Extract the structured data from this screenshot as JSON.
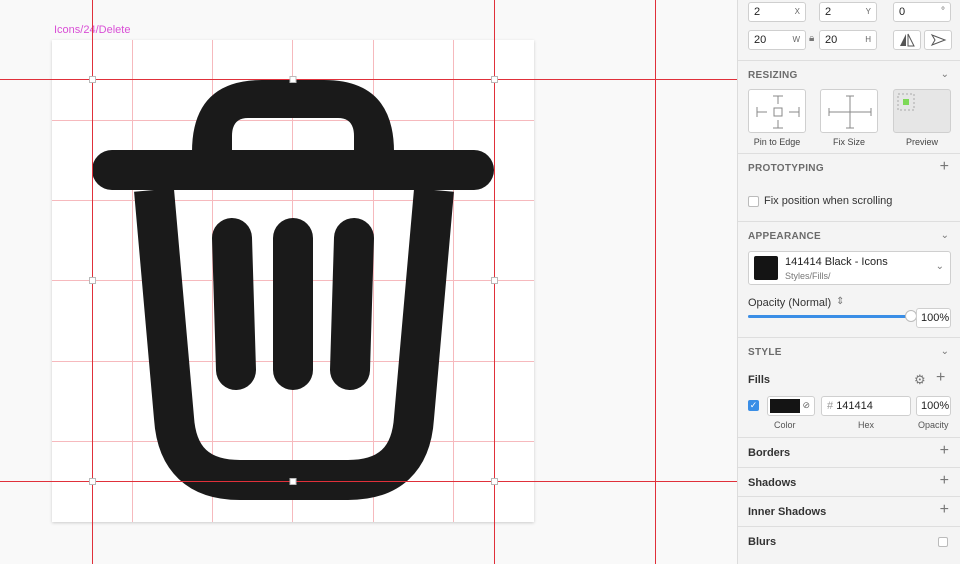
{
  "canvas": {
    "artboard_title": "Icons/24/Delete",
    "icon_fill": "#1a1a1a",
    "guide_color": "#e0303a",
    "grid_color": "#f3a7ad"
  },
  "inspector": {
    "position": {
      "x_value": "2",
      "x_label": "X",
      "y_value": "2",
      "y_label": "Y",
      "rotation_value": "0",
      "rotation_label": "°",
      "w_value": "20",
      "w_label": "W",
      "h_value": "20",
      "h_label": "H"
    },
    "resizing": {
      "title": "RESIZING",
      "pin_label": "Pin to Edge",
      "fix_label": "Fix Size",
      "preview_label": "Preview"
    },
    "prototyping": {
      "title": "PROTOTYPING",
      "fix_position_label": "Fix position when scrolling"
    },
    "appearance": {
      "title": "APPEARANCE",
      "style_name": "141414 Black - Icons",
      "style_path": "Styles/Fills/",
      "opacity_label": "Opacity (Normal)",
      "opacity_value": "100%",
      "opacity_fraction": 1.0,
      "swatch_color": "#141414"
    },
    "style": {
      "title": "STYLE",
      "fills_title": "Fills",
      "fill_hex_prefix": "#",
      "fill_hex": "141414",
      "fill_opacity": "100%",
      "color_label": "Color",
      "hex_label": "Hex",
      "opacity_label": "Opacity",
      "borders_title": "Borders",
      "shadows_title": "Shadows",
      "inner_shadows_title": "Inner Shadows",
      "blurs_title": "Blurs"
    }
  }
}
